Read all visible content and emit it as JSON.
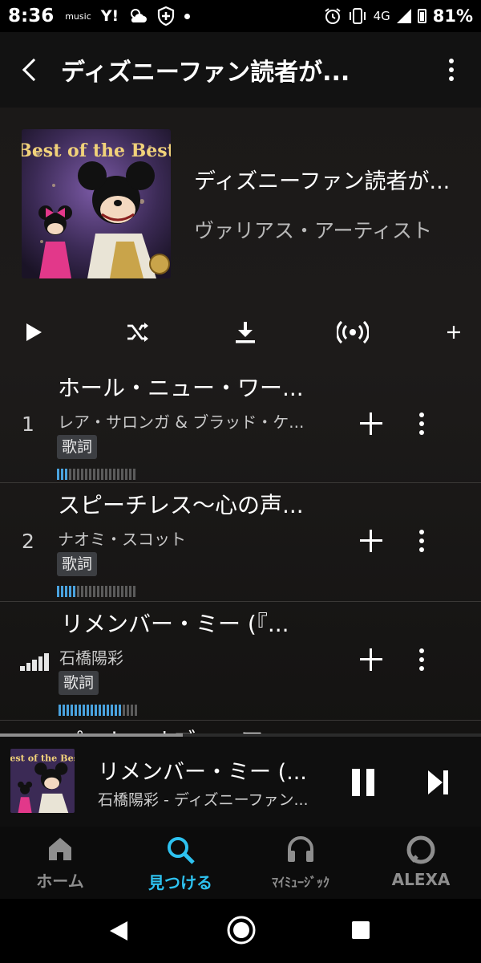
{
  "status_bar": {
    "time": "8:36",
    "icons": [
      "music-icon",
      "yahoo-icon",
      "weather-icon",
      "shield-icon",
      "dot-icon"
    ],
    "app_music_text": "music",
    "yahoo_text": "Y!",
    "network": "4G",
    "battery": "81%"
  },
  "header": {
    "title": "ディズニーファン読者が..."
  },
  "album": {
    "title": "ディズニーファン読者が...",
    "artist": "ヴァリアス・アーティスト",
    "cover_text": "Best of the Best"
  },
  "actions": [
    "play-icon",
    "shuffle-icon",
    "download-icon",
    "broadcast-icon",
    "add-icon"
  ],
  "tracks": [
    {
      "number": "1",
      "title": "ホール・ニュー・ワー...",
      "artist": "レア・サロンガ & ブラッド・ケ...",
      "badge": "歌詞",
      "meter_level": 0.15,
      "now_playing": false
    },
    {
      "number": "2",
      "title": "スピーチレス～心の声...",
      "artist": "ナオミ・スコット",
      "badge": "歌詞",
      "meter_level": 0.25,
      "now_playing": false
    },
    {
      "number": "",
      "title": "リメンバー・ミー (『...",
      "artist": "石橋陽彩",
      "badge": "歌詞",
      "meter_level": 0.8,
      "now_playing": true
    },
    {
      "number": "",
      "title": "パート・オブ・ユア...",
      "artist": "",
      "badge": "",
      "meter_level": 0,
      "now_playing": false
    }
  ],
  "player": {
    "title": "リメンバー・ミー (...",
    "subtitle": "石橋陽彩 - ディズニーファン...",
    "progress": 0.38,
    "cover_text": "Best of the Best"
  },
  "nav": {
    "items": [
      {
        "label": "ホーム",
        "icon": "home-icon",
        "active": false
      },
      {
        "label": "見つける",
        "icon": "search-icon",
        "active": true
      },
      {
        "label": "ﾏｲﾐｭｰｼﾞｯｸ",
        "icon": "headphones-icon",
        "active": false
      },
      {
        "label": "ALEXA",
        "icon": "alexa-icon",
        "active": false
      }
    ]
  },
  "colors": {
    "accent": "#2ec2f0",
    "meter_on": "#4aa3df",
    "background": "#1d1b1a"
  }
}
